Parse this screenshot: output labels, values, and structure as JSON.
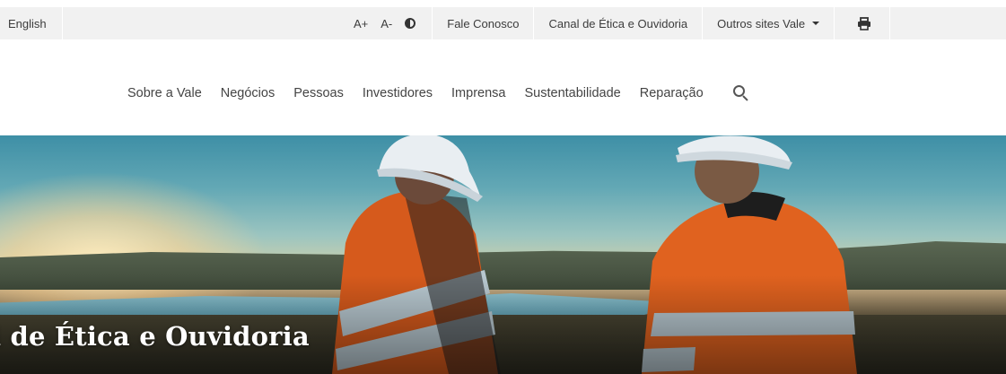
{
  "topbar": {
    "language": "English",
    "font_increase": "A+",
    "font_decrease": "A-",
    "contact": "Fale Conosco",
    "ethics": "Canal de Ética e Ouvidoria",
    "other_sites": "Outros sites Vale"
  },
  "nav": {
    "items": [
      "Sobre a Vale",
      "Negócios",
      "Pessoas",
      "Investidores",
      "Imprensa",
      "Sustentabilidade",
      "Reparação"
    ]
  },
  "hero": {
    "title": "l de Ética e Ouvidoria"
  },
  "icons": {
    "contrast": "contrast-icon",
    "print": "print-icon",
    "search": "search-icon",
    "dropdown": "caret-down-icon"
  },
  "colors": {
    "topbar_bg": "#f1f1f1",
    "nav_text": "#444444",
    "vest_orange": "#e0621f",
    "reflective": "#b8c8d0"
  }
}
